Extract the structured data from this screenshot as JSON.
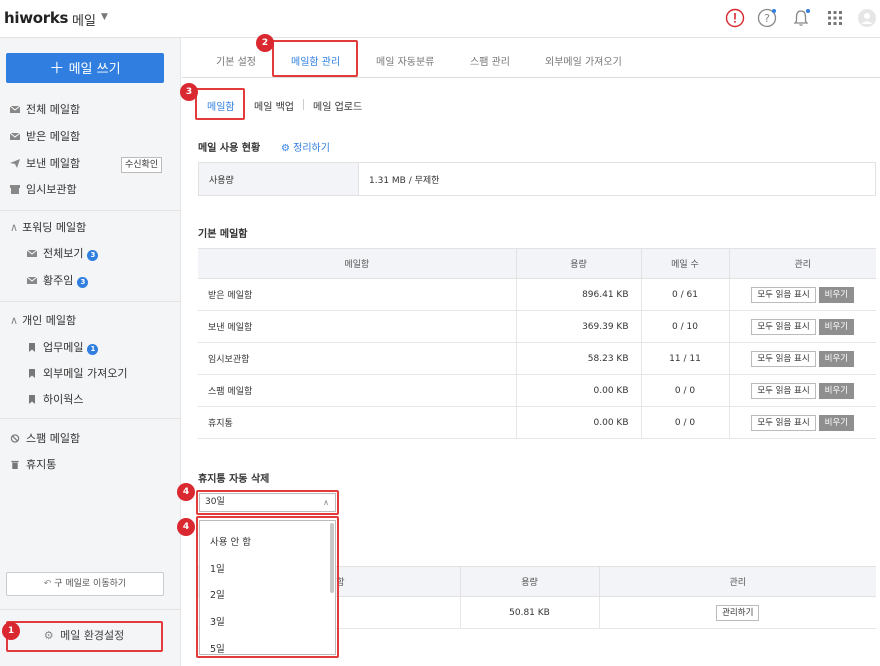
{
  "header": {
    "logo": "hiworks",
    "app_menu": "메일",
    "icons": [
      "alert-icon",
      "help-icon",
      "bell-icon",
      "apps-grid-icon",
      "user-avatar-icon"
    ],
    "accent": "#2f7ee0"
  },
  "sidebar": {
    "compose_label": "메일 쓰기",
    "items": [
      {
        "label": "전체 메일함",
        "icon": "mail-icon"
      },
      {
        "label": "받은 메일함",
        "icon": "mail-icon"
      },
      {
        "label": "보낸 메일함",
        "icon": "send-icon"
      },
      {
        "label": "임시보관함",
        "icon": "archive-icon"
      }
    ],
    "read_check_label": "수신확인",
    "forward_group": {
      "title": "포워딩 메일함",
      "items": [
        {
          "label": "전체보기",
          "badge": "3"
        },
        {
          "label": "황주임",
          "badge": "3"
        }
      ]
    },
    "personal_group": {
      "title": "개인 메일함",
      "items": [
        {
          "label": "업무메일",
          "badge": "1"
        },
        {
          "label": "외부메일 가져오기",
          "badge": ""
        },
        {
          "label": "하이웍스",
          "badge": ""
        }
      ]
    },
    "spam_label": "스팸 메일함",
    "trash_label": "휴지통",
    "go_old_label": "구 메일로 이동하기",
    "settings_label": "메일 환경설정"
  },
  "markers": [
    "1",
    "2",
    "3",
    "4",
    "4"
  ],
  "tabs": [
    "기본 설정",
    "메일함 관리",
    "메일 자동분류",
    "스팸 관리",
    "외부메일 가져오기"
  ],
  "subtabs": [
    "메일함",
    "메일 백업",
    "메일 업로드"
  ],
  "usage": {
    "title": "메일 사용 현황",
    "cleanup_label": "정리하기",
    "row_label": "사용량",
    "row_value": "1.31 MB / 무제한"
  },
  "basic_box": {
    "title": "기본 메일함",
    "headers": [
      "메일함",
      "용량",
      "메일 수",
      "관리"
    ],
    "rows": [
      {
        "name": "받은 메일함",
        "size": "896.41 KB",
        "count": "0 / 61"
      },
      {
        "name": "보낸 메일함",
        "size": "369.39 KB",
        "count": "0 / 10"
      },
      {
        "name": "임시보관함",
        "size": "58.23 KB",
        "count": "11 / 11"
      },
      {
        "name": "스팸 메일함",
        "size": "0.00 KB",
        "count": "0 / 0"
      },
      {
        "name": "휴지통",
        "size": "0.00 KB",
        "count": "0 / 0"
      }
    ],
    "mark_read_label": "모두 읽음 표시",
    "empty_label": "비우기"
  },
  "trash_auto": {
    "title": "휴지통 자동 삭제",
    "selected": "30일",
    "options": [
      "사용 안 함",
      "1일",
      "2일",
      "3일",
      "5일"
    ]
  },
  "second_table": {
    "header_tail": "함",
    "size_header": "용량",
    "manage_header": "관리",
    "size": "50.81 KB",
    "manage_label": "관리하기"
  }
}
